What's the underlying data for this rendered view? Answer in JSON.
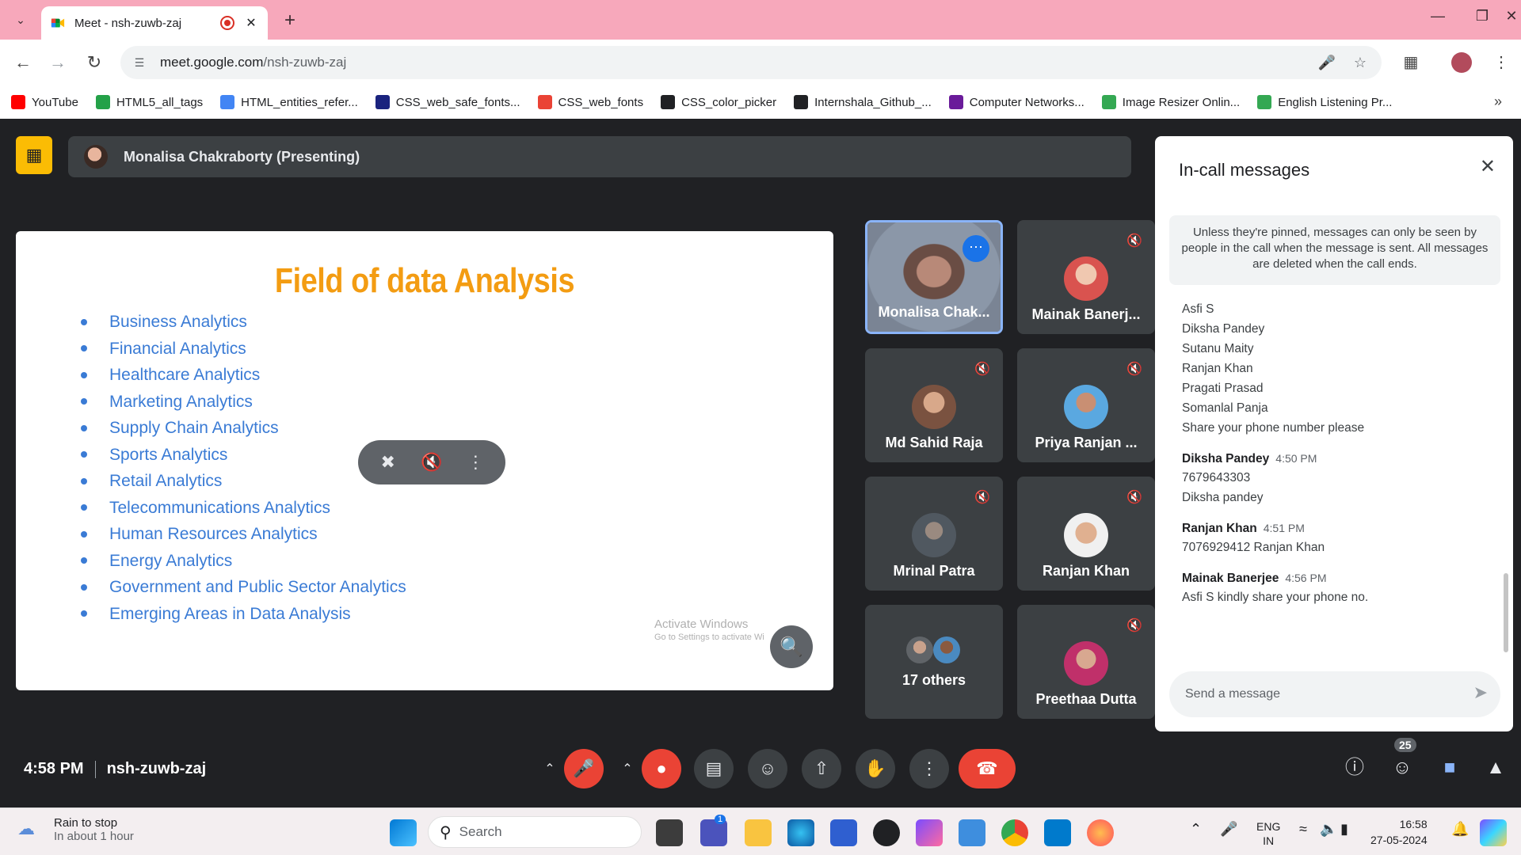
{
  "browser": {
    "tab_title": "Meet - nsh-zuwb-zaj",
    "url_host": "meet.google.com",
    "url_path": "/nsh-zuwb-zaj",
    "bookmarks": [
      {
        "label": "YouTube",
        "color": "#ff0000"
      },
      {
        "label": "HTML5_all_tags",
        "color": "#24a148"
      },
      {
        "label": "HTML_entities_refer...",
        "color": "#4285f4"
      },
      {
        "label": "CSS_web_safe_fonts...",
        "color": "#1a237e"
      },
      {
        "label": "CSS_web_fonts",
        "color": "#ea4335"
      },
      {
        "label": "CSS_color_picker",
        "color": "#202124"
      },
      {
        "label": "Internshala_Github_...",
        "color": "#202124"
      },
      {
        "label": "Computer Networks...",
        "color": "#6a1b9a"
      },
      {
        "label": "Image Resizer Onlin...",
        "color": "#34a853"
      },
      {
        "label": "English Listening Pr...",
        "color": "#34a853"
      }
    ]
  },
  "meet": {
    "presenter_label": "Monalisa Chakraborty (Presenting)",
    "slide": {
      "title": "Field of data Analysis",
      "items": [
        "Business Analytics",
        "Financial Analytics",
        "Healthcare Analytics",
        "Marketing Analytics",
        "Supply Chain Analytics",
        "Sports Analytics",
        "Retail Analytics",
        "Telecommunications Analytics",
        "Human Resources Analytics",
        "Energy Analytics",
        "Government and Public Sector Analytics",
        "Emerging Areas in Data Analysis"
      ],
      "watermark_1": "Activate Windows",
      "watermark_2": "Go to Settings to activate Wi"
    },
    "participants": [
      {
        "name": "Monalisa Chak..."
      },
      {
        "name": "Mainak Banerj..."
      },
      {
        "name": "Md Sahid Raja"
      },
      {
        "name": "Priya Ranjan ..."
      },
      {
        "name": "Mrinal Patra"
      },
      {
        "name": "Ranjan Khan"
      },
      {
        "name": "17 others"
      },
      {
        "name": "Preethaa Dutta"
      }
    ],
    "time": "4:58 PM",
    "meeting_code": "nsh-zuwb-zaj",
    "people_count": "25"
  },
  "chat": {
    "title": "In-call messages",
    "notice": "Unless they're pinned, messages can only be seen by people in the call when the message is sent. All messages are deleted when the call ends.",
    "lines_top": [
      "Asfi S",
      "Diksha Pandey",
      "Sutanu Maity",
      "Ranjan Khan",
      "Pragati Prasad",
      "Somanlal Panja",
      "Share your phone number please"
    ],
    "messages": [
      {
        "sender": "Diksha Pandey",
        "time": "4:50 PM",
        "lines": [
          "7679643303",
          "Diksha pandey"
        ]
      },
      {
        "sender": "Ranjan Khan",
        "time": "4:51 PM",
        "lines": [
          "7076929412 Ranjan Khan"
        ]
      },
      {
        "sender": "Mainak Banerjee",
        "time": "4:56 PM",
        "lines": [
          "Asfi S kindly share your phone no."
        ]
      }
    ],
    "input_placeholder": "Send a message"
  },
  "taskbar": {
    "weather_title": "Rain to stop",
    "weather_sub": "In about 1 hour",
    "search_label": "Search",
    "lang_1": "ENG",
    "lang_2": "IN",
    "clock_time": "16:58",
    "clock_date": "27-05-2024",
    "teams_badge": "1"
  }
}
